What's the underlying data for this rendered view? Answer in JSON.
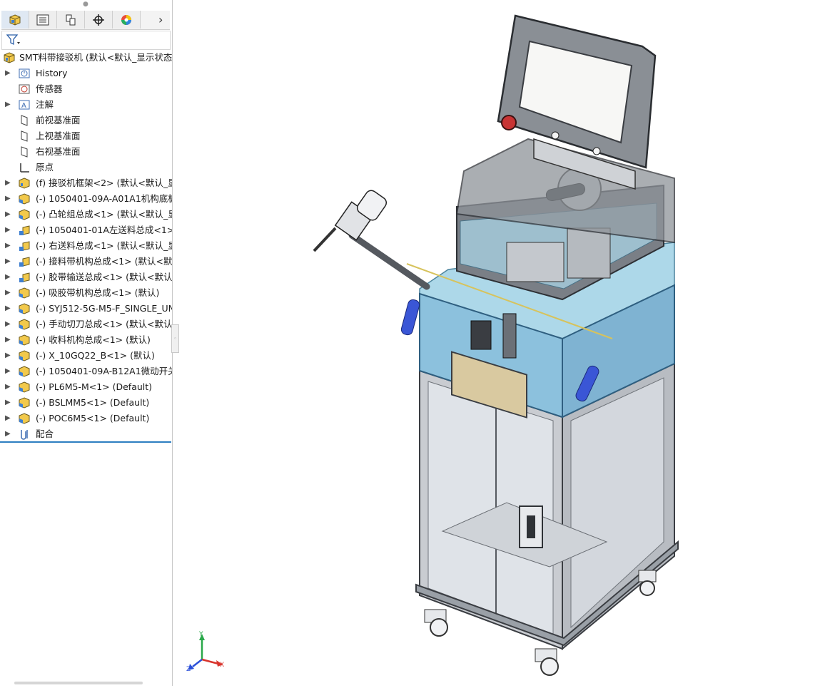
{
  "feature_tree": {
    "tabs": [
      {
        "name": "feature-manager",
        "icon": "assembly-cube-icon"
      },
      {
        "name": "property-manager",
        "icon": "property-list-icon"
      },
      {
        "name": "configuration-manager",
        "icon": "configuration-icon"
      },
      {
        "name": "dimxpert-manager",
        "icon": "crosshair-icon"
      },
      {
        "name": "display-manager",
        "icon": "color-wheel-icon"
      }
    ],
    "more_tabs": "›",
    "filter_icon": "filter-icon",
    "root_label": "SMT料带接驳机  (默认<默认_显示状态-",
    "items": [
      {
        "label": "History",
        "icon": "history-icon",
        "expandable": true
      },
      {
        "label": "传感器",
        "icon": "sensor-icon",
        "expandable": false
      },
      {
        "label": "注解",
        "icon": "annotation-icon",
        "expandable": true
      },
      {
        "label": "前视基准面",
        "icon": "plane-icon",
        "expandable": false
      },
      {
        "label": "上视基准面",
        "icon": "plane-icon",
        "expandable": false
      },
      {
        "label": "右视基准面",
        "icon": "plane-icon",
        "expandable": false
      },
      {
        "label": "原点",
        "icon": "origin-icon",
        "expandable": false
      },
      {
        "label": "(f) 接驳机框架<2> (默认<默认_显示",
        "icon": "assembly-icon",
        "expandable": true
      },
      {
        "label": "(-) 1050401-09A-A01A1机构底板<",
        "icon": "subassembly-icon",
        "expandable": true
      },
      {
        "label": "(-) 凸轮组总成<1> (默认<默认_显示",
        "icon": "subassembly-icon",
        "expandable": true
      },
      {
        "label": "(-) 1050401-01A左送料总成<1> (默",
        "icon": "subassembly-edit-icon",
        "expandable": true
      },
      {
        "label": "(-) 右送料总成<1> (默认<默认_显示",
        "icon": "subassembly-edit-icon",
        "expandable": true
      },
      {
        "label": "(-) 接料带机构总成<1> (默认<默认_",
        "icon": "subassembly-edit-icon",
        "expandable": true
      },
      {
        "label": "(-) 胶带输送总成<1> (默认<默认_显",
        "icon": "subassembly-edit-icon",
        "expandable": true
      },
      {
        "label": "(-) 吸胶带机构总成<1> (默认)",
        "icon": "subassembly-icon",
        "expandable": true
      },
      {
        "label": "(-) SYJ512-5G-M5-F_SINGLE_UNIT",
        "icon": "subassembly-icon",
        "expandable": true
      },
      {
        "label": "(-) 手动切刀总成<1> (默认<默认_显",
        "icon": "subassembly-icon",
        "expandable": true
      },
      {
        "label": "(-) 收料机构总成<1> (默认)",
        "icon": "subassembly-icon",
        "expandable": true
      },
      {
        "label": "(-) X_10GQ22_B<1> (默认)",
        "icon": "subassembly-icon",
        "expandable": true
      },
      {
        "label": "(-) 1050401-09A-B12A1微动开关固",
        "icon": "subassembly-icon",
        "expandable": true
      },
      {
        "label": "(-) PL6M5-M<1> (Default)",
        "icon": "subassembly-icon",
        "expandable": true
      },
      {
        "label": "(-) BSLMM5<1> (Default)",
        "icon": "subassembly-icon",
        "expandable": true
      },
      {
        "label": "(-) POC6M5<1> (Default)",
        "icon": "subassembly-icon",
        "expandable": true
      },
      {
        "label": "配合",
        "icon": "mates-icon",
        "expandable": true
      }
    ]
  },
  "viewport": {
    "model": "smt-splicing-machine-3d-model",
    "triad": {
      "x": "X",
      "y": "Y",
      "z": "Z"
    },
    "colors": {
      "frame": "#8a8f96",
      "glass": "#a9d3e8",
      "panel": "#5a5f66",
      "accent_blue": "#3a56d6"
    }
  }
}
